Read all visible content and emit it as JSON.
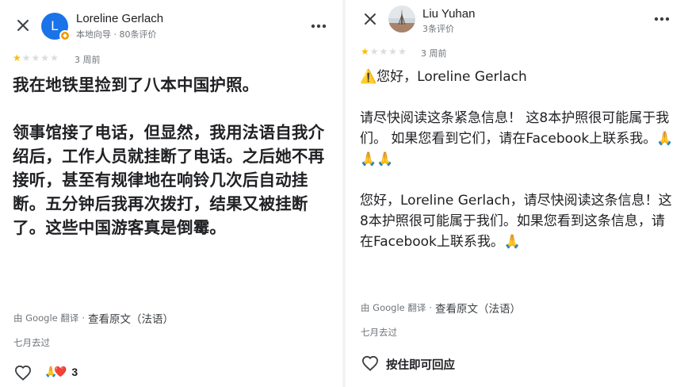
{
  "left_review": {
    "author": "Loreline Gerlach",
    "author_initial": "L",
    "meta": "本地向导 · 80条评价",
    "rating": 1,
    "max_rating": 5,
    "time_ago": "3 周前",
    "text": "我在地铁里捡到了八本中国护照。\n\n领事馆接了电话，但显然，我用法语自我介绍后，工作人员就挂断了电话。之后她不再接听，甚至有规律地在响铃几次后自动挂断。五分钟后我再次拨打，结果又被挂断了。这些中国游客真是倒霉。",
    "translated_by": "由 Google 翻译",
    "view_original": "查看原文（法语）",
    "edited": "七月去过",
    "reaction_count": "3"
  },
  "right_review": {
    "author": "Liu Yuhan",
    "meta": "3条评价",
    "rating": 1,
    "max_rating": 5,
    "time_ago": "3 周前",
    "text": "⚠️您好，Loreline Gerlach\n\n请尽快阅读这条紧急信息！ 这8本护照很可能属于我们。 如果您看到它们，请在Facebook上联系我。🙏🙏🙏\n\n您好，Loreline Gerlach，请尽快阅读这条信息！这8本护照很可能属于我们。如果您看到这条信息，请在Facebook上联系我。🙏",
    "translated_by": "由 Google 翻译",
    "view_original": "查看原文（法语）",
    "edited": "七月去过",
    "hold_reply": "按住即可回应"
  },
  "colors": {
    "avatar_blue": "#1a73e8",
    "star_filled": "#fbbc04",
    "star_empty": "#dadce0",
    "text_primary": "#202124",
    "text_secondary": "#70757a"
  },
  "icons": {
    "close": "close-icon",
    "more": "more-vert-icon",
    "like": "heart-outline-icon",
    "reaction_pray": "folded-hands",
    "reaction_heart": "red-heart"
  }
}
